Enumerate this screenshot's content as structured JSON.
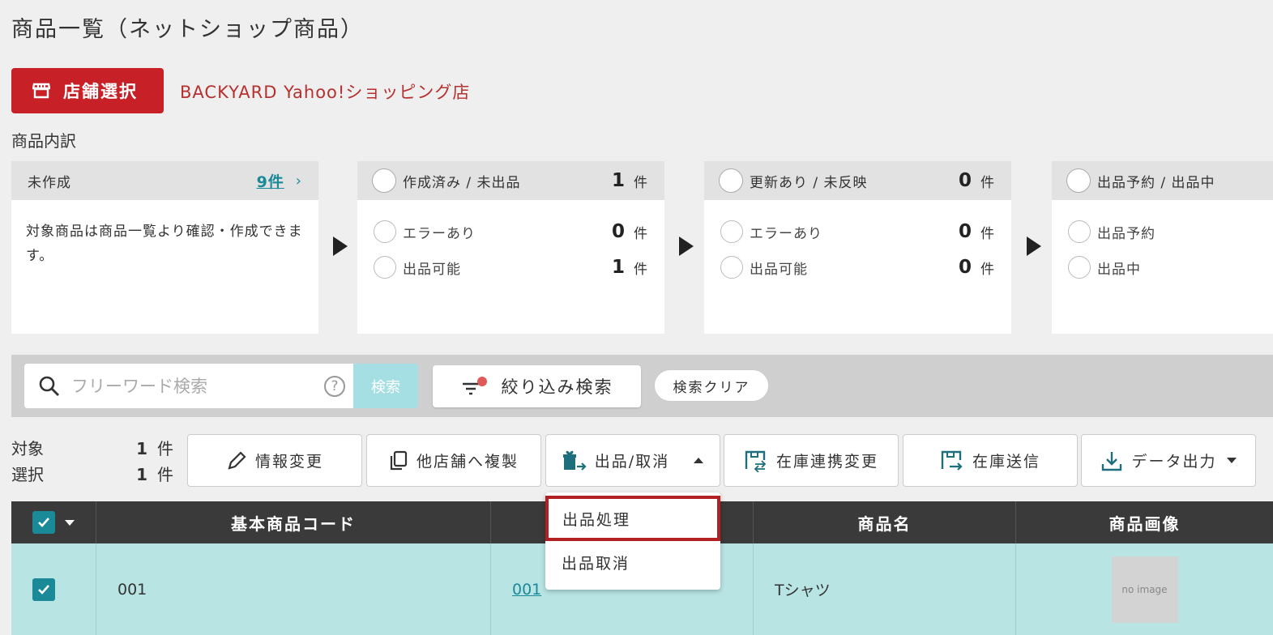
{
  "page": {
    "title": "商品一覧（ネットショップ商品）"
  },
  "store": {
    "button_label": "店舗選択",
    "name": "BACKYARD Yahoo!ショッピング店"
  },
  "breakdown": {
    "title": "商品内訳",
    "not_created": {
      "label": "未作成",
      "count_link": "9件",
      "description": "対象商品は商品一覧より確認・作成できます。"
    },
    "created": {
      "label": "作成済み / 未出品",
      "count": "1",
      "unit": "件",
      "rows": [
        {
          "label": "エラーあり",
          "count": "0",
          "unit": "件"
        },
        {
          "label": "出品可能",
          "count": "1",
          "unit": "件"
        }
      ]
    },
    "updated": {
      "label": "更新あり / 未反映",
      "count": "0",
      "unit": "件",
      "rows": [
        {
          "label": "エラーあり",
          "count": "0",
          "unit": "件"
        },
        {
          "label": "出品可能",
          "count": "0",
          "unit": "件"
        }
      ]
    },
    "listing": {
      "label": "出品予約 / 出品中",
      "rows": [
        {
          "label": "出品予約"
        },
        {
          "label": "出品中"
        }
      ]
    }
  },
  "search": {
    "placeholder": "フリーワード検索",
    "button": "検索",
    "filter": "絞り込み検索",
    "clear": "検索クリア"
  },
  "counts": {
    "target_label": "対象",
    "target_count": "1",
    "selected_label": "選択",
    "selected_count": "1",
    "unit": "件"
  },
  "actions": {
    "edit": "情報変更",
    "copy": "他店舗へ複製",
    "listing": "出品/取消",
    "stock_link": "在庫連携変更",
    "stock_send": "在庫送信",
    "export": "データ出力"
  },
  "dropdown": {
    "items": [
      "出品処理",
      "出品取消"
    ]
  },
  "table": {
    "headers": [
      "基本商品コード",
      "",
      "商品名",
      "商品画像"
    ],
    "rows": [
      {
        "code": "001",
        "link": "001",
        "name": "Tシャツ",
        "image": "no image"
      }
    ]
  },
  "colors": {
    "accent": "#c72027",
    "teal": "#1a8a99",
    "row_bg": "#b8e4e4"
  }
}
